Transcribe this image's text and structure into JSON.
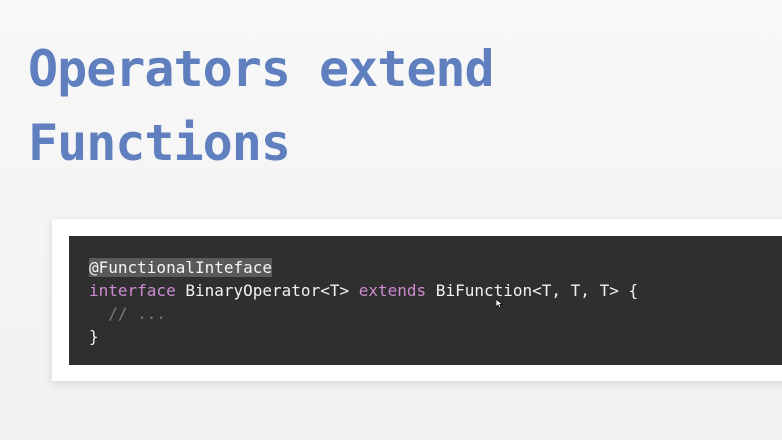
{
  "slide": {
    "title_line1": "Operators extend",
    "title_line2": "Functions"
  },
  "code": {
    "line1": {
      "annotation": "@FunctionalInteface"
    },
    "line2": {
      "kw_interface": "interface",
      "name": " BinaryOperator<T> ",
      "kw_extends": "extends",
      "rest": " BiFunction<T, T, T> {"
    },
    "line3": {
      "comment": "  // ..."
    },
    "line4": {
      "brace": "}"
    }
  },
  "colors": {
    "title": "#5f7fbf",
    "code_background": "#2f2f2f",
    "keyword": "#cc8ad1",
    "comment": "#7b7b7b"
  },
  "icons": {
    "cursor": "mouse-pointer-icon"
  }
}
